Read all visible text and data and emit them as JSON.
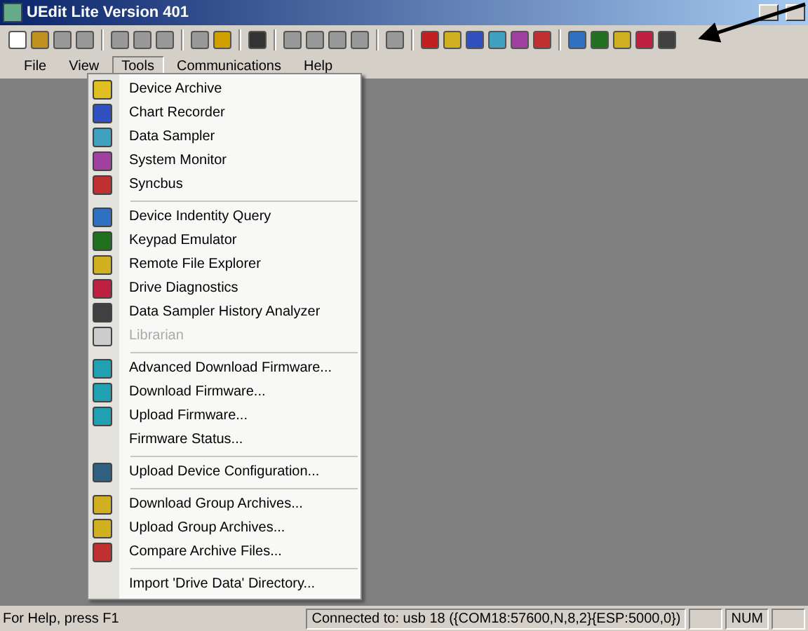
{
  "window": {
    "title": "UEdit Lite Version 401"
  },
  "menu_bar": [
    {
      "label": "File",
      "selected": false
    },
    {
      "label": "View",
      "selected": false
    },
    {
      "label": "Tools",
      "selected": true
    },
    {
      "label": "Communications",
      "selected": false
    },
    {
      "label": "Help",
      "selected": false
    }
  ],
  "tools_menu": {
    "groups": [
      [
        {
          "label": "Device Archive",
          "has_icon": true,
          "disabled": false
        },
        {
          "label": "Chart Recorder",
          "has_icon": true,
          "disabled": false
        },
        {
          "label": "Data Sampler",
          "has_icon": true,
          "disabled": false
        },
        {
          "label": "System Monitor",
          "has_icon": true,
          "disabled": false
        },
        {
          "label": "Syncbus",
          "has_icon": true,
          "disabled": false
        }
      ],
      [
        {
          "label": "Device Indentity Query",
          "has_icon": true,
          "disabled": false
        },
        {
          "label": "Keypad Emulator",
          "has_icon": true,
          "disabled": false
        },
        {
          "label": "Remote File Explorer",
          "has_icon": true,
          "disabled": false
        },
        {
          "label": "Drive Diagnostics",
          "has_icon": true,
          "disabled": false
        },
        {
          "label": "Data Sampler History Analyzer",
          "has_icon": true,
          "disabled": false
        },
        {
          "label": "Librarian",
          "has_icon": true,
          "disabled": true
        }
      ],
      [
        {
          "label": "Advanced Download Firmware...",
          "has_icon": true,
          "disabled": false
        },
        {
          "label": "Download Firmware...",
          "has_icon": true,
          "disabled": false
        },
        {
          "label": "Upload Firmware...",
          "has_icon": true,
          "disabled": false
        },
        {
          "label": "Firmware Status...",
          "has_icon": false,
          "disabled": false
        }
      ],
      [
        {
          "label": "Upload Device Configuration...",
          "has_icon": true,
          "disabled": false
        }
      ],
      [
        {
          "label": "Download Group Archives...",
          "has_icon": true,
          "disabled": false
        },
        {
          "label": "Upload Group Archives...",
          "has_icon": true,
          "disabled": false
        },
        {
          "label": "Compare Archive Files...",
          "has_icon": true,
          "disabled": false
        }
      ],
      [
        {
          "label": "Import 'Drive Data' Directory...",
          "has_icon": false,
          "disabled": false
        }
      ]
    ]
  },
  "status_bar": {
    "help": "For Help, press F1",
    "connection": "Connected to: usb 18 ({COM18:57600,N,8,2}{ESP:5000,0})",
    "num_lock": "NUM"
  }
}
